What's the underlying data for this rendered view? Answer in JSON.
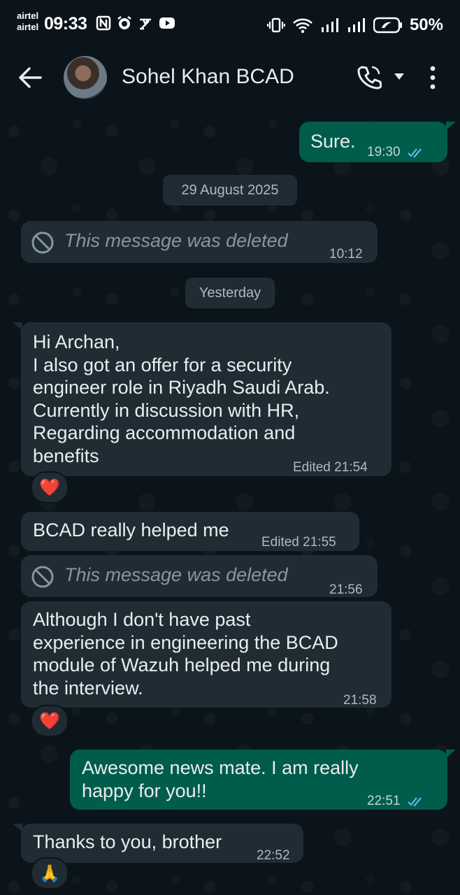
{
  "status_bar": {
    "carrier_1": "airtel",
    "carrier_2": "airtel",
    "time": "09:33",
    "battery": "50%"
  },
  "header": {
    "contact_name": "Sohel Khan BCAD",
    "icons": [
      "back-arrow-icon",
      "avatar",
      "phone-icon",
      "chevron-down-icon",
      "more-vert-icon"
    ]
  },
  "messages": [
    {
      "dir": "out",
      "text": "Sure.",
      "time": "19:30",
      "ticks": "read"
    },
    {
      "type": "date",
      "text": "29 August 2025"
    },
    {
      "dir": "in",
      "deleted": true,
      "text": "This message was deleted",
      "time": "10:12"
    },
    {
      "type": "date",
      "text": "Yesterday"
    },
    {
      "dir": "in",
      "text": "Hi Archan,\nI also got an offer for a security\nengineer role in Riyadh Saudi Arab.\nCurrently in discussion with HR,\nRegarding accommodation and\nbenefits",
      "time": "Edited 21:54",
      "reaction": "❤️"
    },
    {
      "dir": "in",
      "text": "BCAD really helped me",
      "time": "Edited 21:55"
    },
    {
      "dir": "in",
      "deleted": true,
      "text": "This message was deleted",
      "time": "21:56"
    },
    {
      "dir": "in",
      "text": "Although I don't have past\nexperience in engineering the BCAD\nmodule of Wazuh helped me during\nthe interview.",
      "time": "21:58",
      "reaction": "❤️"
    },
    {
      "dir": "out",
      "text": "Awesome news mate. I am really\nhappy for you!!",
      "time": "22:51",
      "ticks": "read"
    },
    {
      "dir": "in",
      "text": "Thanks to you, brother",
      "time": "22:52",
      "reaction": "🙏"
    }
  ],
  "colors": {
    "background": "#0b141a",
    "incoming_bubble": "#202c33",
    "outgoing_bubble": "#005c4b",
    "read_ticks": "#53bdeb"
  }
}
